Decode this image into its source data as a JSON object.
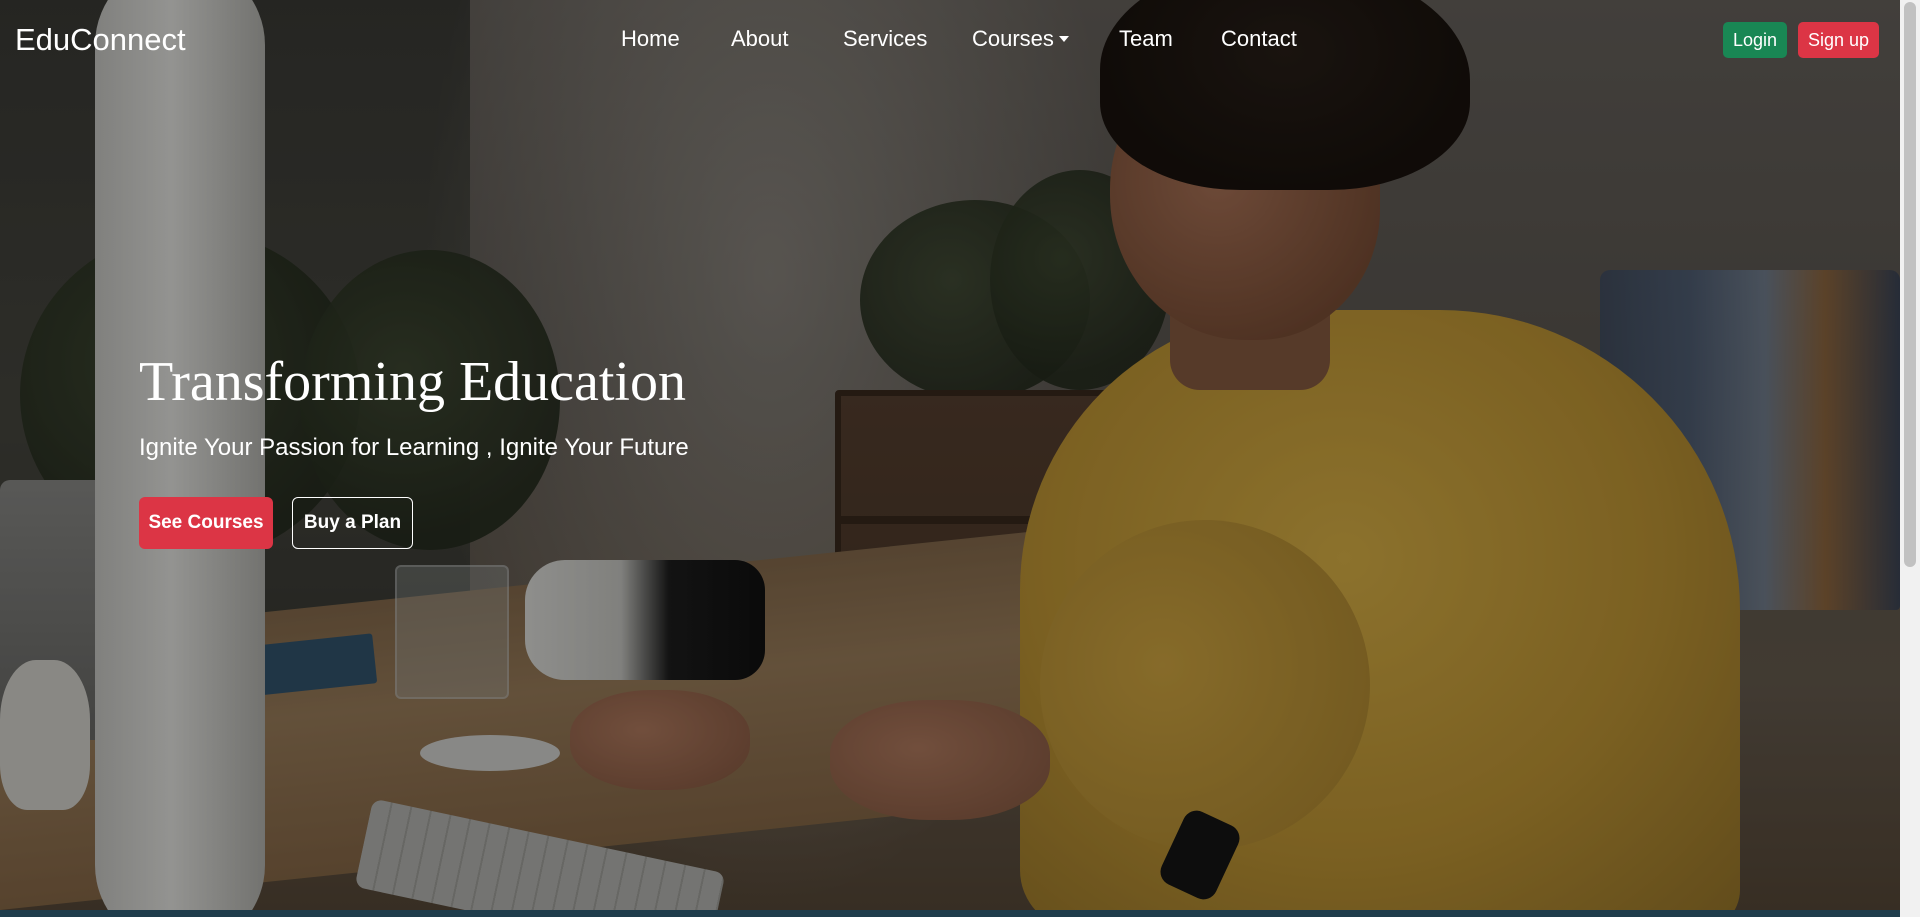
{
  "navbar": {
    "brand": "EduConnect",
    "links": [
      {
        "label": "Home"
      },
      {
        "label": "About"
      },
      {
        "label": "Services"
      },
      {
        "label": "Courses",
        "has_dropdown": true
      },
      {
        "label": "Team"
      },
      {
        "label": "Contact"
      }
    ],
    "login_label": "Login",
    "signup_label": "Sign up"
  },
  "hero": {
    "title": "Transforming Education",
    "subtitle": "Ignite Your Passion for Learning , Ignite Your Future",
    "primary_button": "See Courses",
    "secondary_button": "Buy a Plan"
  },
  "icons": {
    "courses_dropdown": "caret-down-icon"
  },
  "colors": {
    "success": "#198754",
    "danger": "#dc3545",
    "text": "#ffffff"
  }
}
